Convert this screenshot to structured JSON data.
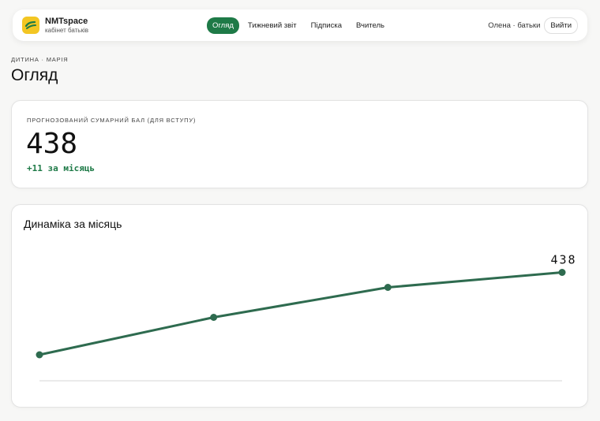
{
  "app": {
    "name": "NMTspace",
    "subtitle": "кабінет батьків"
  },
  "nav": {
    "tabs": [
      {
        "label": "Огляд",
        "active": true
      },
      {
        "label": "Тижневий звіт",
        "active": false
      },
      {
        "label": "Підписка",
        "active": false
      },
      {
        "label": "Вчитель",
        "active": false
      }
    ],
    "user": "Олена · батьки",
    "logout": "Вийти"
  },
  "page": {
    "breadcrumb": "Дитина · Марія",
    "title": "Огляд"
  },
  "score": {
    "label": "Прогнозований сумарний бал (для вступу)",
    "value": "438",
    "delta": "+11 за місяць"
  },
  "chart": {
    "title": "Динаміка за місяць"
  },
  "colors": {
    "accent": "#1e7a47",
    "line": "#2e6b4f",
    "logo": "#f3c623"
  },
  "chart_data": {
    "type": "line",
    "title": "Динаміка за місяць",
    "x": [
      1,
      2,
      3,
      4
    ],
    "values": [
      427,
      432,
      436,
      438
    ],
    "last_label": "438",
    "grid": false,
    "ylim": [
      425,
      439
    ]
  }
}
